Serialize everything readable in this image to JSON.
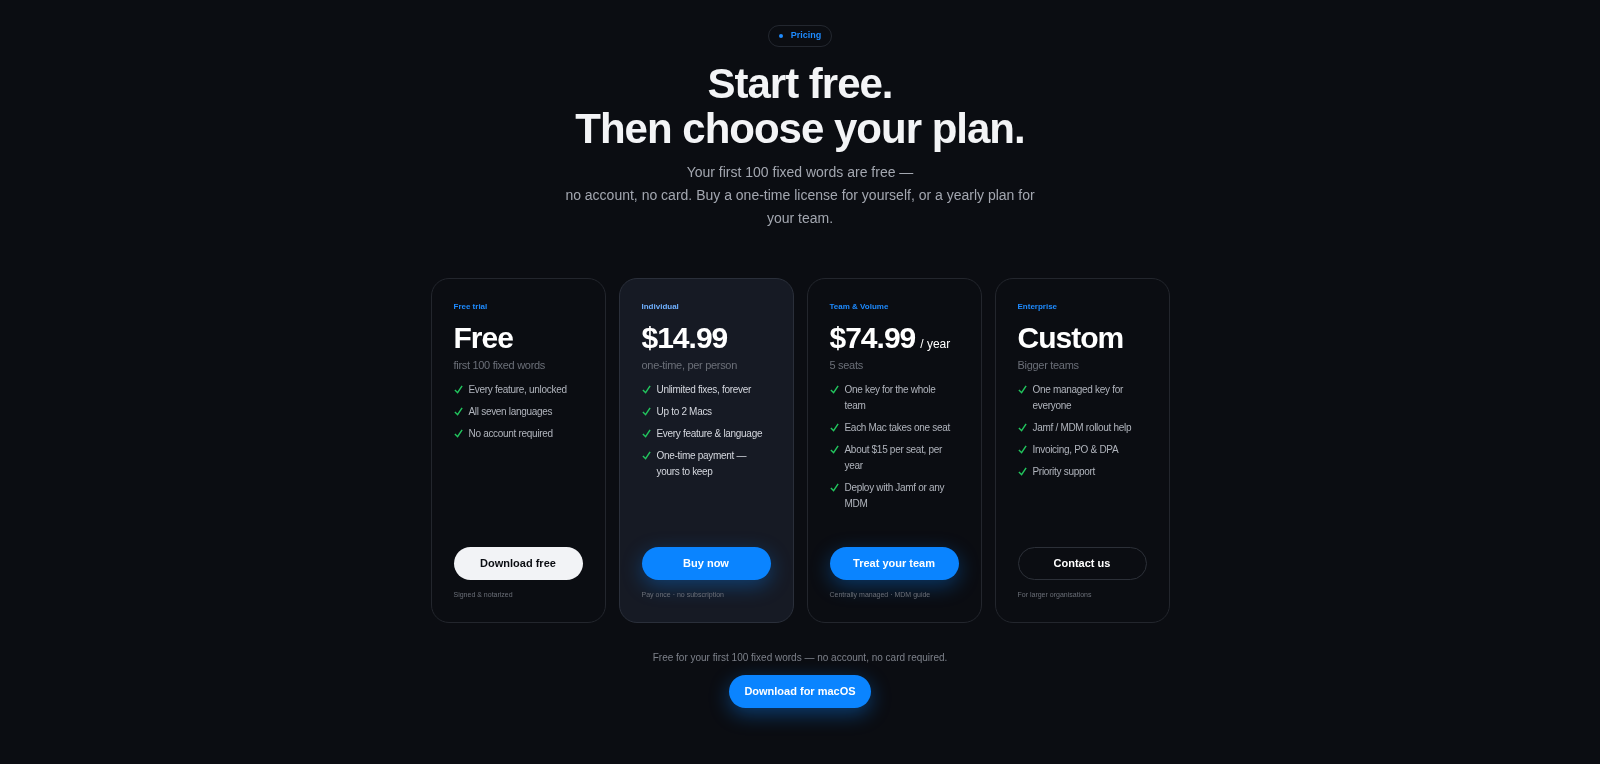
{
  "badge": {
    "label": "Pricing"
  },
  "heading": [
    "Start free.",
    "Then choose your plan."
  ],
  "intro": [
    "Your first 100 fixed words are free —",
    "no account, no card. Buy a one-time license for yourself, or a yearly plan for",
    "your team."
  ],
  "plans": [
    {
      "tier": "Free trial",
      "price": "Free",
      "unit": "first 100 fixed words",
      "featured": false,
      "features": [
        "Every feature, unlocked",
        "All seven languages",
        "No account required"
      ],
      "button": {
        "label": "Download free",
        "kind": "light"
      },
      "note": "Signed & notarized"
    },
    {
      "tier": "Individual",
      "price": "$14.99",
      "unit": "one-time, per person",
      "featured": true,
      "features": [
        "Unlimited fixes, forever",
        "Up to 2 Macs",
        "Every feature & language",
        "One-time payment — yours to keep"
      ],
      "button": {
        "label": "Buy now",
        "kind": "primary"
      },
      "note": "Pay once · no subscription"
    },
    {
      "tier": "Team & Volume",
      "price": "$74.99",
      "period": "/ year",
      "unit": "5 seats",
      "featured": false,
      "features": [
        "One key for the whole team",
        "Each Mac takes one seat",
        "About $15 per seat, per year",
        "Deploy with Jamf or any MDM"
      ],
      "button": {
        "label": "Treat your team",
        "kind": "primary"
      },
      "note": "Centrally managed · MDM guide"
    },
    {
      "tier": "Enterprise",
      "price": "Custom",
      "unit": "Bigger teams",
      "featured": false,
      "features": [
        "One managed key for everyone",
        "Jamf / MDM rollout help",
        "Invoicing, PO & DPA",
        "Priority support"
      ],
      "button": {
        "label": "Contact us",
        "kind": "outline"
      },
      "note": "For larger organisations"
    }
  ],
  "footer": {
    "text": "Free for your first 100 fixed words — no account, no card required.",
    "button": "Download for macOS"
  }
}
